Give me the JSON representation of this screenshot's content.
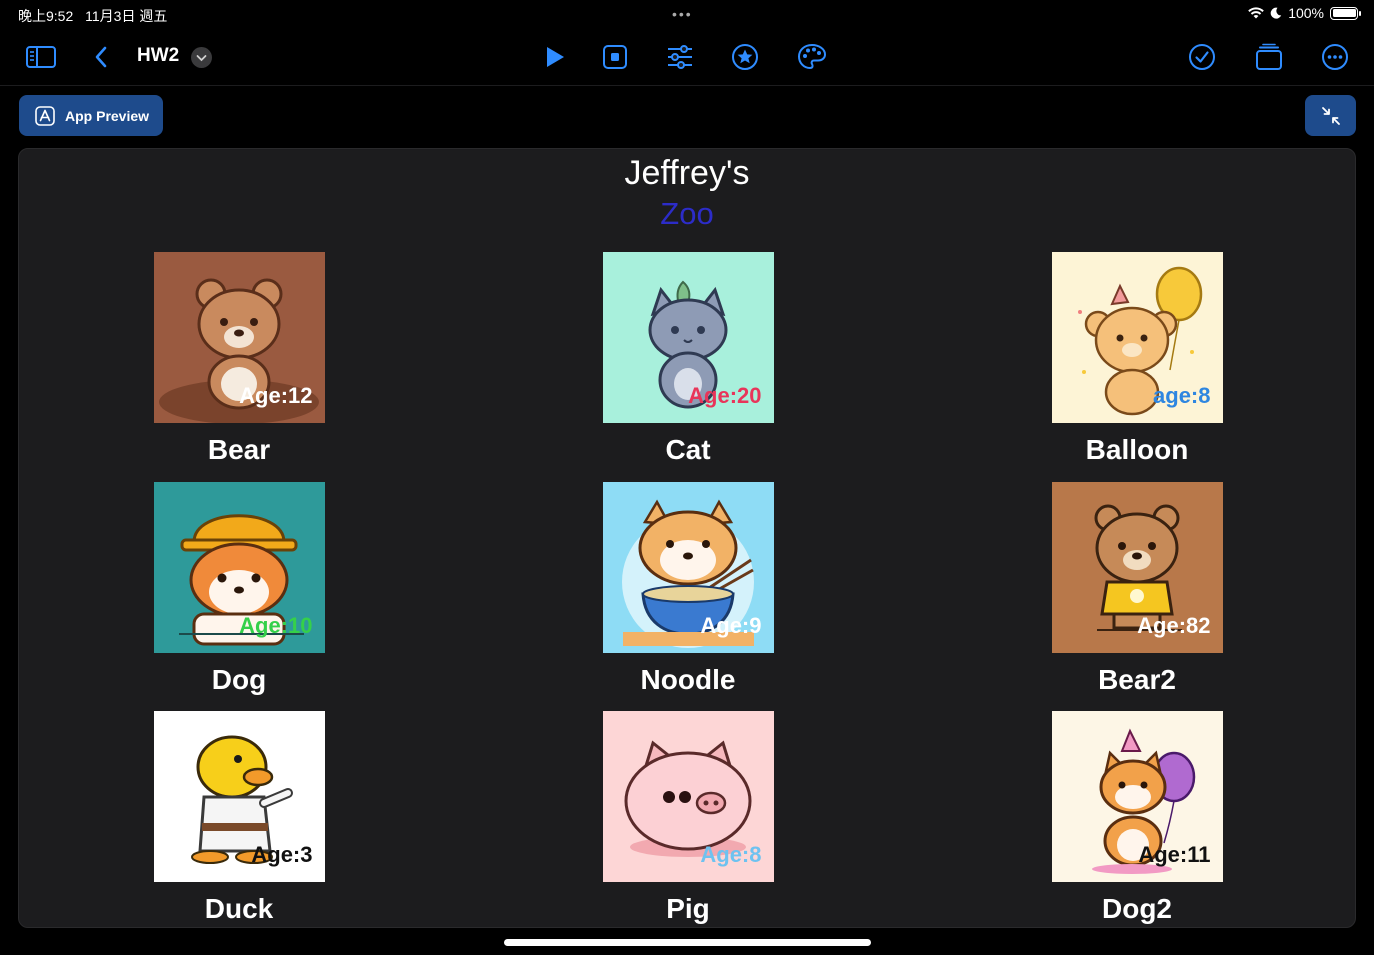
{
  "status": {
    "time": "晚上9:52",
    "date": "11月3日 週五",
    "battery": "100%"
  },
  "toolbar": {
    "title": "HW2"
  },
  "preview": {
    "label": "App Preview"
  },
  "app": {
    "title": "Jeffrey's",
    "subtitle": "Zoo",
    "animals": [
      {
        "name": "Bear",
        "age": "Age:12",
        "age_color": "#ffffff",
        "bg": "#9a5a40"
      },
      {
        "name": "Cat",
        "age": "Age:20",
        "age_color": "#e8355a",
        "bg": "#a8f0dc"
      },
      {
        "name": "Balloon",
        "age": "age:8",
        "age_color": "#2e86e0",
        "bg": "#fdf4d6"
      },
      {
        "name": "Dog",
        "age": "Age:10",
        "age_color": "#35d04a",
        "bg": "#2e9a9a"
      },
      {
        "name": "Noodle",
        "age": "Age:9",
        "age_color": "#ffffff",
        "bg": "#8edcf5"
      },
      {
        "name": "Bear2",
        "age": "Age:82",
        "age_color": "#ffffff",
        "bg": "#b8784a"
      },
      {
        "name": "Duck",
        "age": "Age:3",
        "age_color": "#111111",
        "bg": "#ffffff"
      },
      {
        "name": "Pig",
        "age": "Age:8",
        "age_color": "#6ec2f0",
        "bg": "#fdd6d6"
      },
      {
        "name": "Dog2",
        "age": "Age:11",
        "age_color": "#111111",
        "bg": "#fdf6e6"
      }
    ]
  }
}
